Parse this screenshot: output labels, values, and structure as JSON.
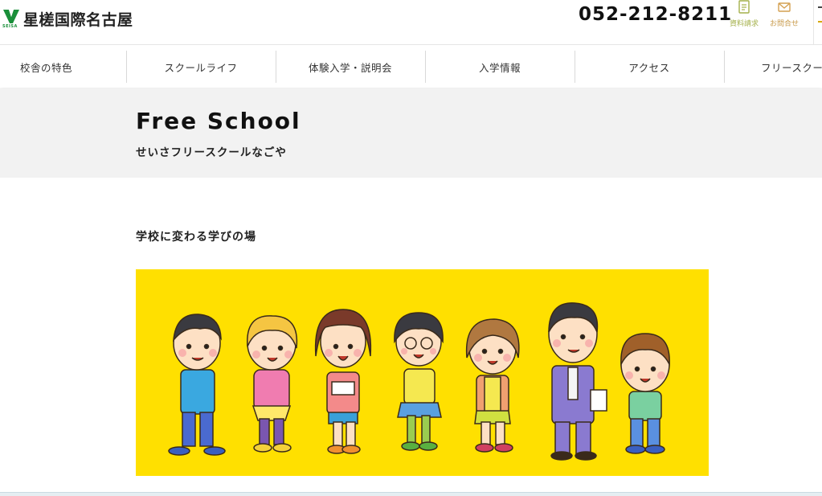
{
  "header": {
    "logo_text": "星槎国際名古屋",
    "logo_sub": "SEISA",
    "phone": "052-212-8211",
    "request_label": "資料請求",
    "contact_label": "お問合せ"
  },
  "nav": {
    "items": [
      {
        "label": "校舎の特色"
      },
      {
        "label": "スクールライフ"
      },
      {
        "label": "体験入学・説明会"
      },
      {
        "label": "入学情報"
      },
      {
        "label": "アクセス"
      },
      {
        "label": "フリースクー"
      }
    ]
  },
  "hero": {
    "title": "Free School",
    "subtitle": "せいさフリースクールなごや"
  },
  "section": {
    "title": "学校に変わる学びの場"
  },
  "colors": {
    "illustration_bg": "#ffe000",
    "brand_green": "#1a8f3a",
    "hero_bg": "#f2f2f2"
  }
}
